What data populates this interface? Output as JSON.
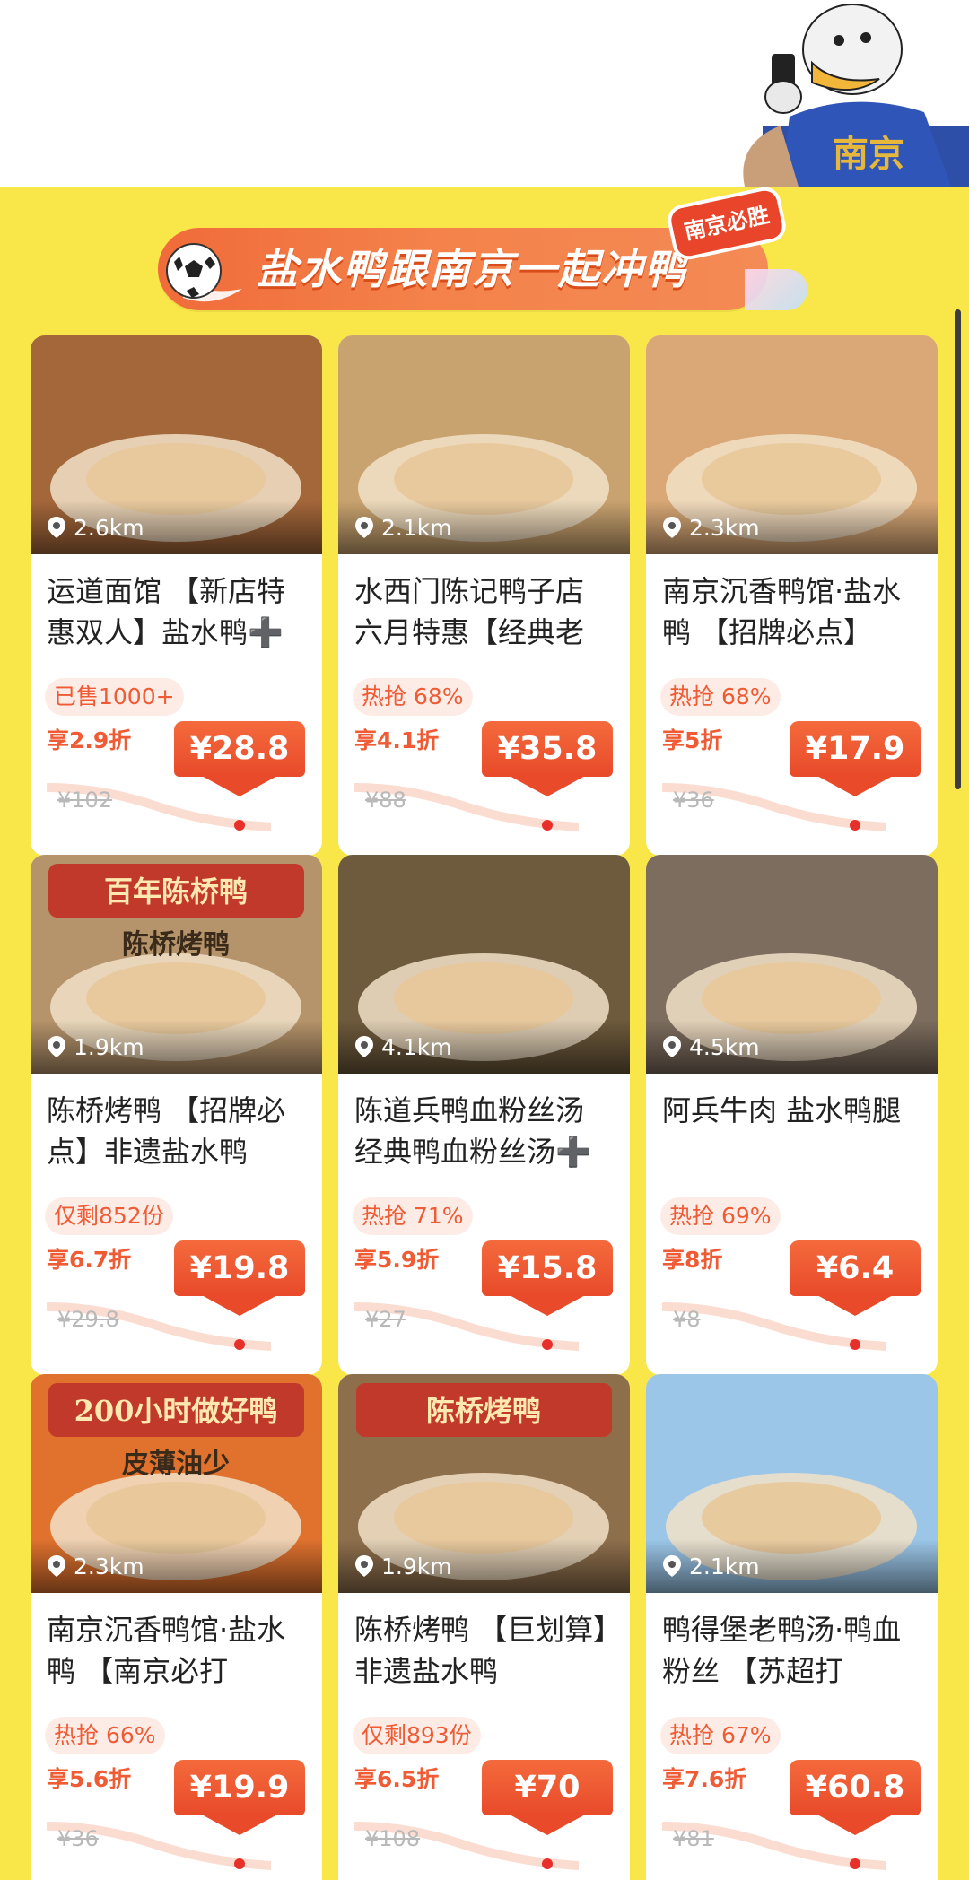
{
  "banner": {
    "title": "盐水鸭跟南京一起冲鸭",
    "tag": "南京必胜"
  },
  "mascot": {
    "shirt_text": "南京"
  },
  "cards": [
    {
      "distance": "2.6km",
      "title": "运道面馆 【新店特惠双人】盐水鸭➕",
      "tag": "已售1000+",
      "discount": "享2.9折",
      "price": "¥28.8",
      "original_price": "¥102",
      "img_color": "#a4673a"
    },
    {
      "distance": "2.1km",
      "title": "水西门陈记鸭子店 六月特惠【经典老",
      "tag": "热抢 68%",
      "discount": "享4.1折",
      "price": "¥35.8",
      "original_price": "¥88",
      "img_color": "#c9a36f"
    },
    {
      "distance": "2.3km",
      "title": "南京沉香鸭馆·盐水鸭 【招牌必点】",
      "tag": "热抢 68%",
      "discount": "享5折",
      "price": "¥17.9",
      "original_price": "¥36",
      "img_color": "#d9a876"
    },
    {
      "distance": "1.9km",
      "title": "陈桥烤鸭 【招牌必点】非遗盐水鸭",
      "tag": "仅剩852份",
      "discount": "享6.7折",
      "price": "¥19.8",
      "original_price": "¥29.8",
      "img_color": "#b6946b"
    },
    {
      "distance": "4.1km",
      "title": "陈道兵鸭血粉丝汤 经典鸭血粉丝汤➕",
      "tag": "热抢 71%",
      "discount": "享5.9折",
      "price": "¥15.8",
      "original_price": "¥27",
      "img_color": "#6e5a3c"
    },
    {
      "distance": "4.5km",
      "title": "阿兵牛肉 盐水鸭腿",
      "tag": "热抢 69%",
      "discount": "享8折",
      "price": "¥6.4",
      "original_price": "¥8",
      "img_color": "#7d6d5e"
    },
    {
      "distance": "2.3km",
      "title": "南京沉香鸭馆·盐水鸭 【南京必打",
      "tag": "热抢 66%",
      "discount": "享5.6折",
      "price": "¥19.9",
      "original_price": "¥36",
      "img_color": "#e0722e"
    },
    {
      "distance": "1.9km",
      "title": "陈桥烤鸭 【巨划算】非遗盐水鸭",
      "tag": "仅剩893份",
      "discount": "享6.5折",
      "price": "¥70",
      "original_price": "¥108",
      "img_color": "#8e6f4c"
    },
    {
      "distance": "2.1km",
      "title": "鸭得堡老鸭汤·鸭血粉丝 【苏超打",
      "tag": "热抢 67%",
      "discount": "享7.6折",
      "price": "¥60.8",
      "original_price": "¥81",
      "img_color": "#9bc6e8"
    }
  ],
  "card_images": [
    {
      "banner_text": ""
    },
    {
      "banner_text": ""
    },
    {
      "banner_text": ""
    },
    {
      "banner_text": "百年陈桥鸭",
      "sub_text": "陈桥烤鸭"
    },
    {
      "banner_text": ""
    },
    {
      "banner_text": ""
    },
    {
      "banner_text": "200小时做好鸭",
      "sub_text": "皮薄油少"
    },
    {
      "banner_text": "陈桥烤鸭"
    },
    {
      "banner_text": ""
    }
  ]
}
